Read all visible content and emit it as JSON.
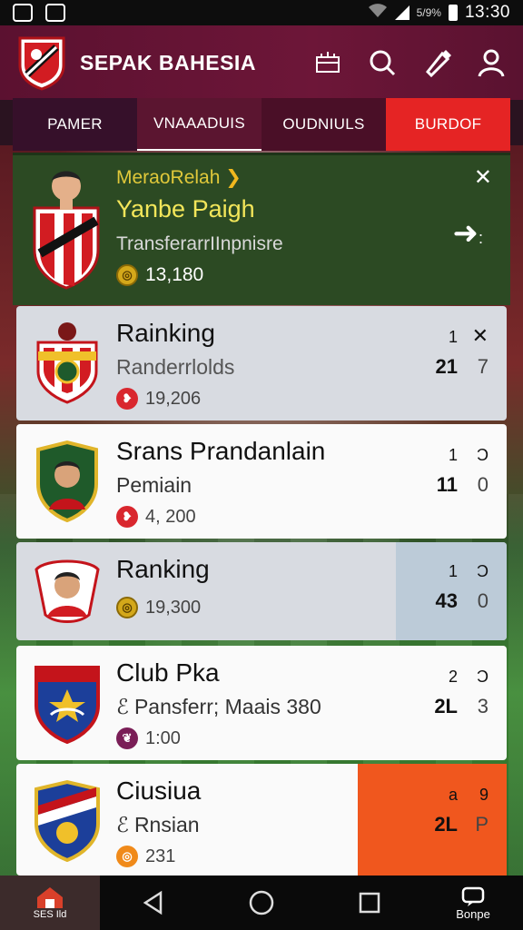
{
  "status_bar": {
    "battery": "5/9%",
    "time": "13:30"
  },
  "app": {
    "title": "SEPAK BAHESIA"
  },
  "tabs": [
    {
      "label": "PAMER"
    },
    {
      "label": "VNAAADUIS"
    },
    {
      "label": "OUDNIULS"
    },
    {
      "label": "BURDOF"
    }
  ],
  "featured": {
    "subtitle": "MeraoRelah",
    "name": "Yanbe Paigh",
    "desc": "TransferarrIInpnisre",
    "coins": "13,180"
  },
  "rows": [
    {
      "title": "Rainking",
      "sub": "Randerrlolds",
      "coins": "19,206",
      "stat_top": "1",
      "stat_bottom_left": "21",
      "stat_bottom_right": "7",
      "close": "✕"
    },
    {
      "title": "Srans Prandanlain",
      "sub": "Pemiain",
      "coins": "4, 200",
      "stat_top": "1",
      "stat_top_right": "Ɔ",
      "stat_bottom_left": "11",
      "stat_bottom_right": "0"
    },
    {
      "title": "Ranking",
      "sub": "",
      "coins": "19,300",
      "stat_top": "1",
      "stat_top_right": "Ɔ",
      "stat_bottom_left": "43",
      "stat_bottom_right": "0"
    },
    {
      "title": "Club Pka",
      "sub": "Pansferr; Maais 380",
      "coins": "1:00",
      "stat_top": "2",
      "stat_top_right": "Ɔ",
      "stat_bottom_left": "2L",
      "stat_bottom_right": "3"
    },
    {
      "title": "Ciusiua",
      "sub": "Rnsian",
      "coins": "231",
      "stat_top": "a",
      "stat_top_right": "9",
      "stat_bottom_left": "2L",
      "stat_bottom_right": "P"
    }
  ],
  "nav": {
    "home_label": "SES Ild",
    "more_label": "Bonpe"
  }
}
